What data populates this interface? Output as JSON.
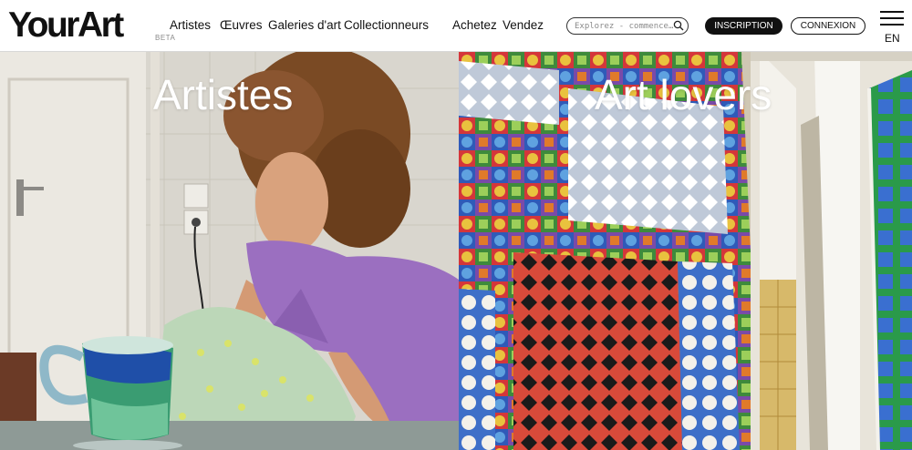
{
  "header": {
    "logo": "YourArt",
    "beta": "BETA",
    "nav": {
      "artistes": "Artistes",
      "oeuvres": "Œuvres",
      "galeries": "Galeries d'art",
      "collectionneurs": "Collectionneurs",
      "achetez": "Achetez",
      "vendez": "Vendez"
    },
    "search_placeholder": "Explorez - commence…",
    "inscription": "INSCRIPTION",
    "connexion": "CONNEXION",
    "language": "EN"
  },
  "hero": {
    "left_title": "Artistes",
    "right_title": "Art lovers"
  },
  "colors": {
    "text": "#111111",
    "background": "#ffffff",
    "shirt": "#9b6fc0",
    "mosaic": [
      "#d4363a",
      "#3e8a3c",
      "#2f5ab8",
      "#e9c23e",
      "#7a4aa8",
      "#e07a2a",
      "#1a1a1a"
    ]
  },
  "icons": {
    "search": "search-icon",
    "menu": "hamburger-menu-icon"
  }
}
